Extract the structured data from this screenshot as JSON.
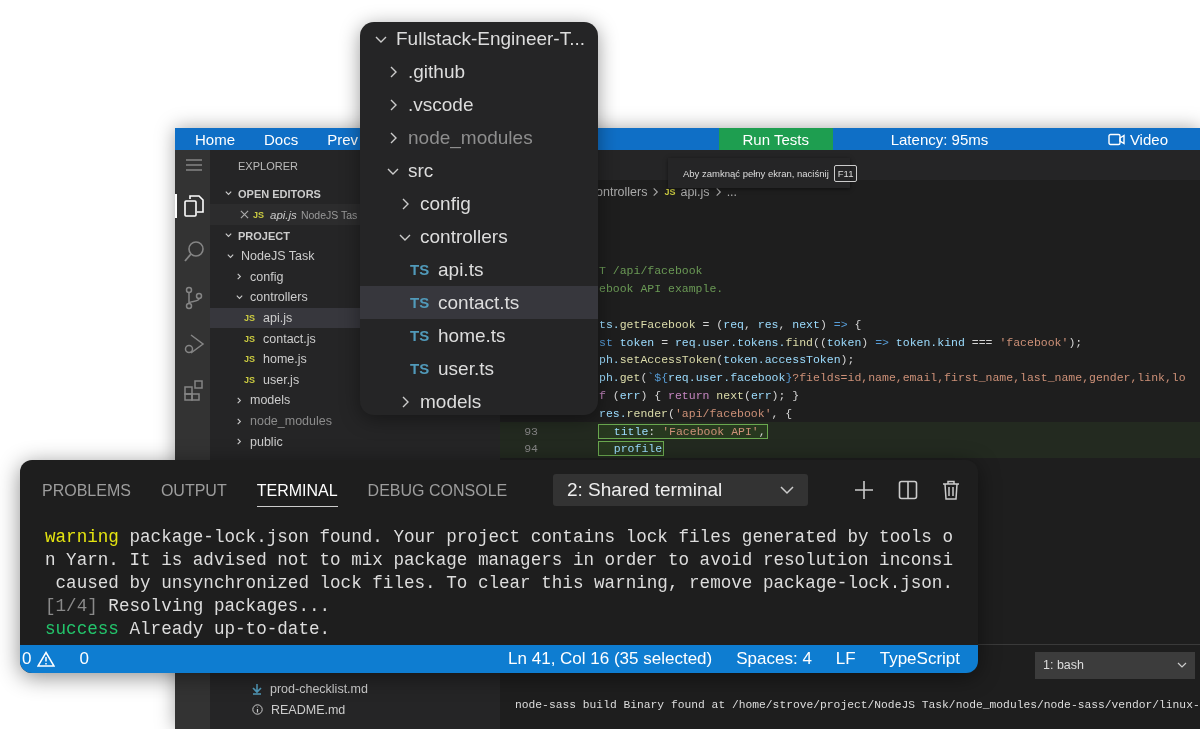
{
  "editor_window": {
    "top_bar": {
      "links": [
        {
          "label": "Home"
        },
        {
          "label": "Docs"
        },
        {
          "label": "Prev"
        }
      ],
      "run_button": "Run Tests",
      "latency": "Latency: 95ms",
      "video_button": "Video"
    },
    "activity_bar": [
      {
        "kind": "menu",
        "selected": false
      },
      {
        "kind": "files",
        "selected": true
      },
      {
        "kind": "search",
        "selected": false
      },
      {
        "kind": "source-control",
        "selected": false
      },
      {
        "kind": "debug",
        "selected": false
      },
      {
        "kind": "extensions",
        "selected": false
      }
    ],
    "sidebar": {
      "title": "EXPLORER",
      "open_editors": {
        "title": "OPEN EDITORS",
        "files": [
          {
            "badge": "JS",
            "name": "api.js",
            "folder": "NodeJS Tas"
          }
        ]
      },
      "project": {
        "title": "PROJECT",
        "tree": [
          {
            "name": "NodeJS Task",
            "kind": "folder",
            "expanded": true,
            "selected": false,
            "dimmed": false,
            "children": [
              {
                "name": "config",
                "kind": "folder",
                "expanded": false,
                "selected": false,
                "dimmed": false
              },
              {
                "name": "controllers",
                "kind": "folder",
                "expanded": true,
                "selected": false,
                "dimmed": false,
                "children": [
                  {
                    "name": "api.js",
                    "kind": "file",
                    "badge": "JS",
                    "selected": true,
                    "dimmed": false
                  },
                  {
                    "name": "contact.js",
                    "kind": "file",
                    "badge": "JS",
                    "selected": false,
                    "dimmed": false
                  },
                  {
                    "name": "home.js",
                    "kind": "file",
                    "badge": "JS",
                    "selected": false,
                    "dimmed": false
                  },
                  {
                    "name": "user.js",
                    "kind": "file",
                    "badge": "JS",
                    "selected": false,
                    "dimmed": false
                  }
                ]
              },
              {
                "name": "models",
                "kind": "folder",
                "expanded": false,
                "selected": false,
                "dimmed": false
              },
              {
                "name": "node_modules",
                "kind": "folder",
                "expanded": false,
                "selected": false,
                "dimmed": true
              },
              {
                "name": "public",
                "kind": "folder",
                "expanded": false,
                "selected": false,
                "dimmed": false
              }
            ]
          }
        ]
      },
      "bottom_files": [
        {
          "name": "prod-checklist.md",
          "kind": "download"
        },
        {
          "name": "README.md",
          "kind": "info"
        }
      ]
    },
    "fullscreen_tooltip": {
      "text": "Aby zamknąć pełny ekran, naciśnij",
      "key": "F11"
    },
    "breadcrumb": [
      {
        "text": "ontrollers"
      },
      {
        "text": "api.js",
        "badge": "JS"
      },
      {
        "text": "..."
      }
    ],
    "code_lines": [
      {
        "kind": "code",
        "highlighted": false,
        "segments": [
          {
            "t": "T /api/facebook",
            "kind": "comment"
          }
        ]
      },
      {
        "kind": "code",
        "highlighted": false,
        "segments": [
          {
            "t": "ebook API example.",
            "kind": "comment"
          }
        ]
      },
      {
        "kind": "blank",
        "highlighted": false
      },
      {
        "kind": "code",
        "highlighted": false,
        "segments": [
          {
            "t": "ts.",
            "kind": "var"
          },
          {
            "t": "getFacebook",
            "kind": "func"
          },
          {
            "t": " = (",
            "kind": "punct"
          },
          {
            "t": "req",
            "kind": "var"
          },
          {
            "t": ", ",
            "kind": "punct"
          },
          {
            "t": "res",
            "kind": "var"
          },
          {
            "t": ", ",
            "kind": "punct"
          },
          {
            "t": "next",
            "kind": "var"
          },
          {
            "t": ") ",
            "kind": "punct"
          },
          {
            "t": "=>",
            "kind": "keyword"
          },
          {
            "t": " {",
            "kind": "punct"
          }
        ]
      },
      {
        "kind": "code",
        "highlighted": false,
        "segments": [
          {
            "t": "st",
            "kind": "keyword"
          },
          {
            "t": " token",
            "kind": "var"
          },
          {
            "t": " = ",
            "kind": "punct"
          },
          {
            "t": "req.user.tokens.",
            "kind": "var"
          },
          {
            "t": "find",
            "kind": "func"
          },
          {
            "t": "((",
            "kind": "punct"
          },
          {
            "t": "token",
            "kind": "var"
          },
          {
            "t": ") ",
            "kind": "punct"
          },
          {
            "t": "=>",
            "kind": "keyword"
          },
          {
            "t": " token.kind",
            "kind": "var"
          },
          {
            "t": " === ",
            "kind": "punct"
          },
          {
            "t": "'facebook'",
            "kind": "string"
          },
          {
            "t": ");",
            "kind": "punct"
          }
        ]
      },
      {
        "kind": "code",
        "highlighted": false,
        "segments": [
          {
            "t": "ph.",
            "kind": "var"
          },
          {
            "t": "setAccessToken",
            "kind": "func"
          },
          {
            "t": "(",
            "kind": "punct"
          },
          {
            "t": "token.accessToken",
            "kind": "var"
          },
          {
            "t": ");",
            "kind": "punct"
          }
        ]
      },
      {
        "kind": "code",
        "highlighted": false,
        "segments": [
          {
            "t": "ph.",
            "kind": "var"
          },
          {
            "t": "get",
            "kind": "func"
          },
          {
            "t": "(",
            "kind": "punct"
          },
          {
            "t": "`${",
            "kind": "keyword"
          },
          {
            "t": "req.user.facebook",
            "kind": "var"
          },
          {
            "t": "}",
            "kind": "keyword"
          },
          {
            "t": "?fields=id,name,email,first_name,last_name,gender,link,lo",
            "kind": "string"
          }
        ]
      },
      {
        "kind": "code",
        "highlighted": false,
        "segments": [
          {
            "t": "f",
            "kind": "control"
          },
          {
            "t": " (",
            "kind": "punct"
          },
          {
            "t": "err",
            "kind": "var"
          },
          {
            "t": ") { ",
            "kind": "punct"
          },
          {
            "t": "return",
            "kind": "control"
          },
          {
            "t": " next",
            "kind": "func"
          },
          {
            "t": "(",
            "kind": "punct"
          },
          {
            "t": "err",
            "kind": "var"
          },
          {
            "t": "); }",
            "kind": "punct"
          }
        ]
      },
      {
        "kind": "code",
        "highlighted": false,
        "segments": [
          {
            "t": "res.",
            "kind": "var"
          },
          {
            "t": "render",
            "kind": "func"
          },
          {
            "t": "(",
            "kind": "punct"
          },
          {
            "t": "'api/facebook'",
            "kind": "string"
          },
          {
            "t": ", {",
            "kind": "punct"
          }
        ]
      },
      {
        "kind": "code",
        "number": "93",
        "highlighted": true,
        "segments": [
          {
            "t": "  title",
            "kind": "var"
          },
          {
            "t": ": ",
            "kind": "punct"
          },
          {
            "t": "'Facebook API'",
            "kind": "string"
          },
          {
            "t": ",",
            "kind": "punct"
          }
        ]
      },
      {
        "kind": "code",
        "number": "94",
        "highlighted": true,
        "segments": [
          {
            "t": "  profile",
            "kind": "var"
          }
        ]
      }
    ],
    "terminal": {
      "dropdown": "1: bash",
      "output": "node-sass build Binary found at /home/strove/project/NodeJS Task/node_modules/node-sass/vendor/linux-"
    }
  },
  "explorer_popup": {
    "tree": [
      {
        "name": "Fullstack-Engineer-T...",
        "kind": "folder",
        "expanded": true,
        "selected": false,
        "dimmed": false,
        "children": [
          {
            "name": ".github",
            "kind": "folder",
            "expanded": false,
            "selected": false,
            "dimmed": false
          },
          {
            "name": ".vscode",
            "kind": "folder",
            "expanded": false,
            "selected": false,
            "dimmed": false
          },
          {
            "name": "node_modules",
            "kind": "folder",
            "expanded": false,
            "selected": false,
            "dimmed": true
          },
          {
            "name": "src",
            "kind": "folder",
            "expanded": true,
            "selected": false,
            "dimmed": false,
            "children": [
              {
                "name": "config",
                "kind": "folder",
                "expanded": false,
                "selected": false,
                "dimmed": false
              },
              {
                "name": "controllers",
                "kind": "folder",
                "expanded": true,
                "selected": false,
                "dimmed": false,
                "children": [
                  {
                    "name": "api.ts",
                    "kind": "file",
                    "badge": "TS",
                    "selected": false,
                    "dimmed": false
                  },
                  {
                    "name": "contact.ts",
                    "kind": "file",
                    "badge": "TS",
                    "selected": true,
                    "dimmed": false
                  },
                  {
                    "name": "home.ts",
                    "kind": "file",
                    "badge": "TS",
                    "selected": false,
                    "dimmed": false
                  },
                  {
                    "name": "user.ts",
                    "kind": "file",
                    "badge": "TS",
                    "selected": false,
                    "dimmed": false
                  }
                ]
              },
              {
                "name": "models",
                "kind": "folder",
                "expanded": false,
                "selected": false,
                "dimmed": false
              }
            ]
          }
        ]
      }
    ]
  },
  "terminal_panel": {
    "tabs": [
      {
        "label": "PROBLEMS",
        "selected": false
      },
      {
        "label": "OUTPUT",
        "selected": false
      },
      {
        "label": "TERMINAL",
        "selected": true
      },
      {
        "label": "DEBUG CONSOLE",
        "selected": false
      }
    ],
    "dropdown": "2: Shared terminal",
    "lines": [
      {
        "prefix": {
          "text": "warning",
          "kind": "warning"
        },
        "text": " package-lock.json found. Your project contains lock files generated by tools o"
      },
      {
        "text": "n Yarn. It is advised not to mix package managers in order to avoid resolution inconsi"
      },
      {
        "text": " caused by unsynchronized lock files. To clear this warning, remove package-lock.json."
      },
      {
        "prefix": {
          "text": "[1/4]",
          "kind": "step"
        },
        "text": " Resolving packages..."
      },
      {
        "prefix": {
          "text": "success",
          "kind": "success"
        },
        "text": " Already up-to-date."
      }
    ],
    "status_bar": {
      "errors": "0",
      "warnings": "0",
      "cursor": "Ln 41, Col 16 (35 selected)",
      "spaces": "Spaces: 4",
      "eol": "LF",
      "language": "TypeScript"
    }
  }
}
